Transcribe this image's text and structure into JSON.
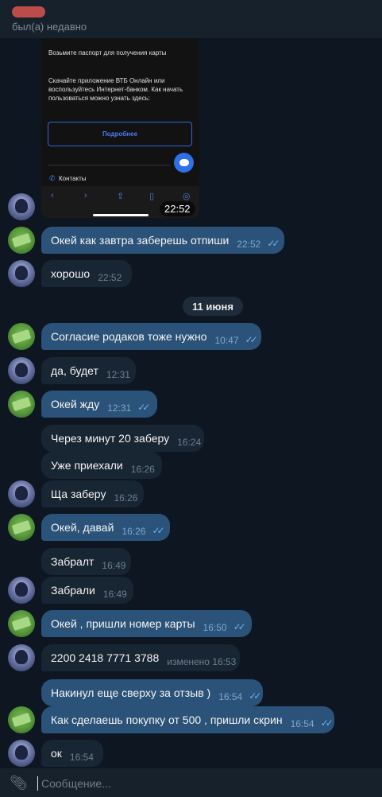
{
  "header": {
    "last_seen": "был(а) недавно"
  },
  "screenshot": {
    "line1": "Возьмите паспорт для получения карты",
    "line2": "Скачайте приложение ВТБ Онлайн или воспользуйтесь Интернет-банком. Как начать пользоваться можно узнать здесь:",
    "button": "Подробнее",
    "contacts": "Контакты",
    "time": "22:52"
  },
  "date_separator": "11 июня",
  "messages": [
    {
      "text": "Окей как завтра заберешь отпиши",
      "time": "22:52"
    },
    {
      "text": "хорошо",
      "time": "22:52"
    },
    {
      "text": "Согласие родаков тоже нужно",
      "time": "10:47"
    },
    {
      "text": "да, будет",
      "time": "12:31"
    },
    {
      "text": "Окей жду",
      "time": "12:31"
    },
    {
      "text": "Через минут 20 заберу",
      "time": "16:24"
    },
    {
      "text": "Уже приехали",
      "time": "16:26"
    },
    {
      "text": "Ща заберу",
      "time": "16:26"
    },
    {
      "text": "Окей, давай",
      "time": "16:26"
    },
    {
      "text": "Забралт",
      "time": "16:49"
    },
    {
      "text": "Забрали",
      "time": "16:49"
    },
    {
      "text": "Окей , пришли номер карты",
      "time": "16:50"
    },
    {
      "text": "2200 2418 7771 3788",
      "time": "изменено 16:53"
    },
    {
      "text": "Накинул еще сверху за отзыв )",
      "time": "16:54"
    },
    {
      "text": "Как сделаешь покупку от 500 , пришли скрин",
      "time": "16:54"
    },
    {
      "text": "ок",
      "time": "16:54"
    }
  ],
  "composer": {
    "placeholder": "Сообщение..."
  },
  "colors": {
    "background": "#0e1621",
    "incoming_bubble": "#182533",
    "outgoing_bubble": "#2b5278",
    "read_check": "#6ab2f2"
  }
}
